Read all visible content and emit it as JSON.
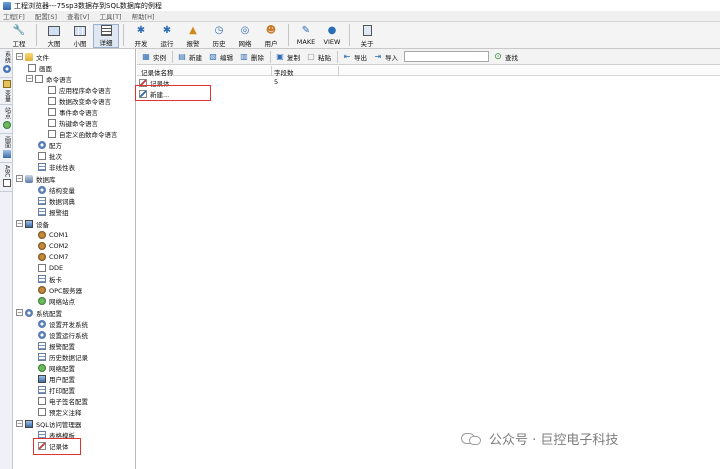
{
  "window": {
    "title": "工程浏览器---75sp3数据存到SQL数据库的例程"
  },
  "menu": [
    "工程[F]",
    "配置[S]",
    "查看[V]",
    "工具[T]",
    "帮助[H]"
  ],
  "toolbar": {
    "tools": [
      {
        "name": "project",
        "label": "工程",
        "icon": "wrench-icon"
      },
      {
        "name": "large-icon",
        "label": "大图",
        "icon": "large-icon-view-icon"
      },
      {
        "name": "small-icon",
        "label": "小图",
        "icon": "small-icon-view-icon"
      },
      {
        "name": "detail",
        "label": "详细",
        "icon": "detail-view-icon",
        "active": true
      },
      {
        "name": "develop",
        "label": "开发",
        "icon": "develop-icon"
      },
      {
        "name": "run",
        "label": "运行",
        "icon": "run-icon"
      },
      {
        "name": "alarm",
        "label": "报警",
        "icon": "alarm-icon"
      },
      {
        "name": "history",
        "label": "历史",
        "icon": "history-icon"
      },
      {
        "name": "network",
        "label": "网络",
        "icon": "network-icon"
      },
      {
        "name": "user",
        "label": "用户",
        "icon": "user-icon"
      },
      {
        "name": "make",
        "label": "MAKE",
        "icon": "make-icon"
      },
      {
        "name": "view",
        "label": "VIEW",
        "icon": "view-icon"
      },
      {
        "name": "about",
        "label": "关于",
        "icon": "about-icon"
      }
    ]
  },
  "side_tabs": [
    {
      "label": "系统",
      "icon": "system-icon"
    },
    {
      "label": "变量",
      "icon": "variable-icon"
    },
    {
      "label": "站点",
      "icon": "station-icon"
    },
    {
      "label": "画面",
      "icon": "screen-icon"
    },
    {
      "label": "ABC",
      "icon": "abc-icon"
    }
  ],
  "tree": {
    "file": "文件",
    "screen": "画面",
    "command_language": "命令语言",
    "app_cmd": "应用程序命令语言",
    "data_change_cmd": "数据改变命令语言",
    "event_cmd": "事件命令语言",
    "hotkey_cmd": "热键命令语言",
    "custom_func_cmd": "自定义函数命令语言",
    "recipe": "配方",
    "batch": "批次",
    "nonlinear_table": "非线性表",
    "database": "数据库",
    "struct_var": "结构变量",
    "data_dict": "数据词典",
    "alarm_group": "报警组",
    "device": "设备",
    "com1": "COM1",
    "com2": "COM2",
    "com7": "COM7",
    "dde": "DDE",
    "board": "板卡",
    "opc": "OPC服务器",
    "net_station": "网络站点",
    "sys_config": "系统配置",
    "dev_config": "设置开发系统",
    "run_config": "设置运行系统",
    "alarm_config": "报警配置",
    "history_config": "历史数据记录",
    "network_config": "网络配置",
    "user_config": "用户配置",
    "print_config": "打印配置",
    "esign_config": "电子签名配置",
    "predefine_note": "预定义注释",
    "sql_manager": "SQL访问管理器",
    "table_template": "表格模板",
    "recordset": "记录体"
  },
  "sub_toolbar": {
    "instance": "实例",
    "new": "新建",
    "edit": "编辑",
    "delete": "删除",
    "copy": "复制",
    "paste": "粘贴",
    "export": "导出",
    "import": "导入",
    "import_value": "",
    "find": "查找"
  },
  "list": {
    "columns": [
      "记录体名称",
      "字段数"
    ],
    "rows": [
      {
        "name": "记录体",
        "fields": "5"
      },
      {
        "name": "新建...",
        "fields": ""
      }
    ]
  },
  "watermark": {
    "text": "公众号 · 巨控电子科技"
  },
  "colors": {
    "highlight_box": "#e03232",
    "toolbar_bg": "#f4f4f4",
    "menubar_bg": "#f0f0f0"
  }
}
